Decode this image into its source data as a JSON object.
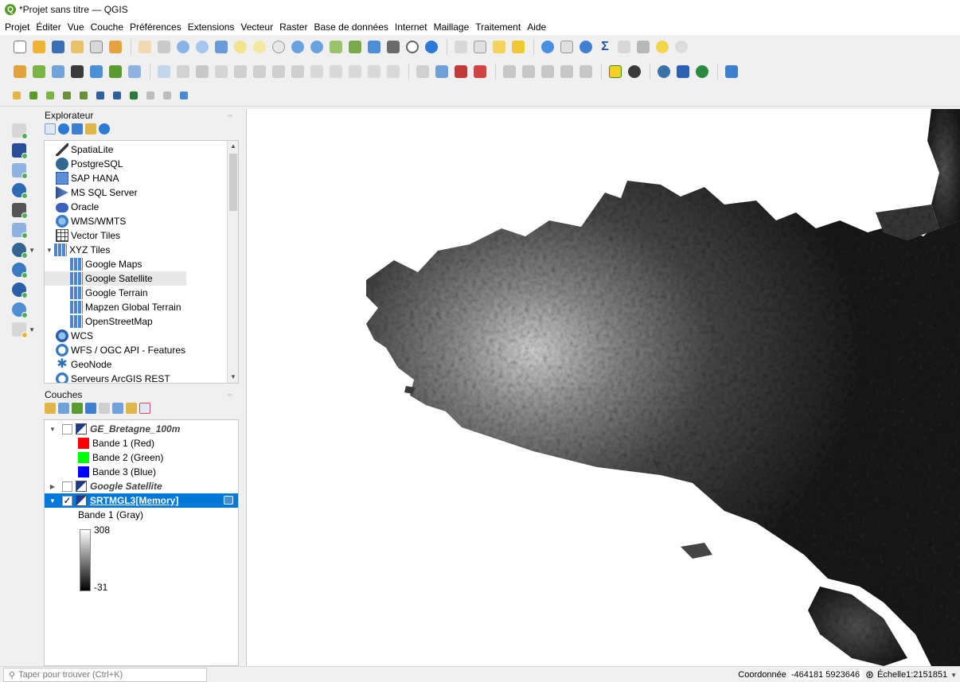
{
  "window": {
    "title": "*Projet sans titre — QGIS"
  },
  "menus": [
    "Projet",
    "Éditer",
    "Vue",
    "Couche",
    "Préférences",
    "Extensions",
    "Vecteur",
    "Raster",
    "Base de données",
    "Internet",
    "Maillage",
    "Traitement",
    "Aide"
  ],
  "browser": {
    "title": "Explorateur",
    "items": [
      {
        "label": "SpatiaLite",
        "icon": "spatialite-icon",
        "color": "#3a3a3a"
      },
      {
        "label": "PostgreSQL",
        "icon": "postgresql-icon",
        "color": "#336791"
      },
      {
        "label": "SAP HANA",
        "icon": "sap-hana-icon",
        "color": "#5a8fd8"
      },
      {
        "label": "MS SQL Server",
        "icon": "mssql-icon",
        "color": "#2e4d8f"
      },
      {
        "label": "Oracle",
        "icon": "oracle-icon",
        "color": "#3a5fbf"
      },
      {
        "label": "WMS/WMTS",
        "icon": "wms-icon",
        "color": "#3b7bbf"
      },
      {
        "label": "Vector Tiles",
        "icon": "vector-tiles-icon",
        "color": "#4a4a4a"
      },
      {
        "label": "XYZ Tiles",
        "icon": "xyz-tiles-icon",
        "color": "#4a86d8"
      },
      {
        "label": "Google Maps",
        "icon": "xyz-tile-icon",
        "color": "#4a86d8"
      },
      {
        "label": "Google Satellite",
        "icon": "xyz-tile-icon",
        "color": "#4a86d8"
      },
      {
        "label": "Google Terrain",
        "icon": "xyz-tile-icon",
        "color": "#4a86d8"
      },
      {
        "label": "Mapzen Global Terrain",
        "icon": "xyz-tile-icon",
        "color": "#4a86d8"
      },
      {
        "label": "OpenStreetMap",
        "icon": "xyz-tile-icon",
        "color": "#4a86d8"
      },
      {
        "label": "WCS",
        "icon": "wcs-icon",
        "color": "#3b7bbf"
      },
      {
        "label": "WFS / OGC API - Features",
        "icon": "wfs-icon",
        "color": "#3b7bbf"
      },
      {
        "label": "GeoNode",
        "icon": "geonode-icon",
        "color": "#2f6fb3"
      },
      {
        "label": "Serveurs ArcGIS REST",
        "icon": "arcgis-icon",
        "color": "#3b7bbf"
      }
    ]
  },
  "layers": {
    "title": "Couches",
    "items": [
      {
        "name": "GE_Bretagne_100m",
        "checked": "",
        "bands": [
          "Bande 1 (Red)",
          "Bande 2 (Green)",
          "Bande 3 (Blue)"
        ]
      },
      {
        "name": "Google Satellite",
        "checked": ""
      },
      {
        "name": "SRTMGL3[Memory]",
        "checked": "✓",
        "band": "Bande 1 (Gray)",
        "max": "308",
        "min": "-31"
      }
    ],
    "band_colors": [
      "#ff0000",
      "#00ff00",
      "#0000ff"
    ]
  },
  "status": {
    "search_placeholder": "Taper pour trouver (Ctrl+K)",
    "coord_label": "Coordonnée",
    "coord_value": "-464181 5923646",
    "scale_label": "Échelle",
    "scale_value": "1:2151851"
  },
  "colors": {
    "selection": "#0078d7",
    "qgis_green": "#5a9b2e"
  }
}
